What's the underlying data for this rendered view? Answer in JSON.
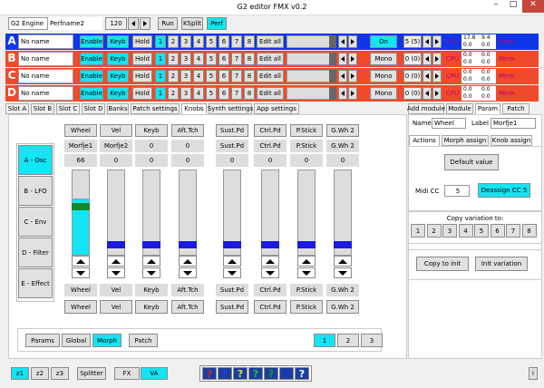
{
  "window": {
    "title": "G2 editor FMX v0.2"
  },
  "top": {
    "engine": "G2 Engine",
    "perf_name": "Perfname2",
    "tempo": "120",
    "run": "Run",
    "ksplit": "KSplit",
    "perf": "Perf"
  },
  "slots": [
    {
      "letter": "A",
      "name": "No name",
      "enable": "Enable",
      "keyb": "Keyb",
      "hold": "Hold",
      "vars": [
        "1",
        "2",
        "3",
        "4",
        "5",
        "6",
        "7",
        "8"
      ],
      "edit_all": "Edit all",
      "mode": "On",
      "voices": "5 (5)",
      "cpu": "CPU",
      "cpu1": "17.8",
      "cpu2": "9.4",
      "cpu3": "0.0",
      "cpu4": "0.0",
      "mem": "Mem",
      "color": "#0f36e8"
    },
    {
      "letter": "B",
      "name": "No name",
      "enable": "Enable",
      "keyb": "Keyb",
      "hold": "Hold",
      "vars": [
        "1",
        "2",
        "3",
        "4",
        "5",
        "6",
        "7",
        "8"
      ],
      "edit_all": "Edit all",
      "mode": "Mono",
      "voices": "0 (0)",
      "cpu": "CPU",
      "cpu1": "0.0",
      "cpu2": "0.0",
      "cpu3": "0.0",
      "cpu4": "0.0",
      "mem": "Mem",
      "color": "#f04a2a"
    },
    {
      "letter": "C",
      "name": "No name",
      "enable": "Enable",
      "keyb": "Keyb",
      "hold": "Hold",
      "vars": [
        "1",
        "2",
        "3",
        "4",
        "5",
        "6",
        "7",
        "8"
      ],
      "edit_all": "Edit all",
      "mode": "Mono",
      "voices": "0 (0)",
      "cpu": "CPU",
      "cpu1": "0.0",
      "cpu2": "0.0",
      "cpu3": "0.0",
      "cpu4": "0.0",
      "mem": "Mem",
      "color": "#f04a2a"
    },
    {
      "letter": "D",
      "name": "No name",
      "enable": "Enable",
      "keyb": "Keyb",
      "hold": "Hold",
      "vars": [
        "1",
        "2",
        "3",
        "4",
        "5",
        "6",
        "7",
        "8"
      ],
      "edit_all": "Edit all",
      "mode": "Mono",
      "voices": "0 (0)",
      "cpu": "CPU",
      "cpu1": "0.0",
      "cpu2": "0.0",
      "cpu3": "0.0",
      "cpu4": "0.0",
      "mem": "Mem",
      "color": "#f04a2a"
    }
  ],
  "tabs": [
    "Slot A",
    "Slot B",
    "Slot C",
    "Slot D",
    "Banks",
    "Patch settings",
    "Knobs",
    "Synth settings",
    "App settings"
  ],
  "right_tabs": [
    "Add module",
    "Module",
    "Param",
    "Patch"
  ],
  "side_buttons": [
    "A - Osc",
    "B - LFO",
    "C - Env",
    "D - Filter",
    "E - Effect"
  ],
  "knobs": [
    {
      "head": "Wheel",
      "sub": "Morfje1",
      "val": "66",
      "level": 0.66,
      "foot1": "Wheel",
      "foot2": "Wheel"
    },
    {
      "head": "Vel",
      "sub": "Morfje2",
      "val": "0",
      "level": 0,
      "foot1": "Vel",
      "foot2": "Vel"
    },
    {
      "head": "Keyb",
      "sub": "0",
      "val": "0",
      "level": 0,
      "foot1": "Keyb",
      "foot2": "Keyb"
    },
    {
      "head": "Aft.Tch",
      "sub": "0",
      "val": "0",
      "level": 0,
      "foot1": "Aft.Tch",
      "foot2": "Aft.Tch"
    },
    {
      "head": "Sust.Pd",
      "sub": "Sust.Pd",
      "val": "0",
      "level": 0,
      "foot1": "Sust.Pd",
      "foot2": "Sust.Pd"
    },
    {
      "head": "Ctrl.Pd",
      "sub": "Ctrl.Pd",
      "val": "0",
      "level": 0,
      "foot1": "Ctrl.Pd",
      "foot2": "Ctrl.Pd"
    },
    {
      "head": "P.Stick",
      "sub": "P.Stick",
      "val": "0",
      "level": 0,
      "foot1": "P.Stick",
      "foot2": "P.Stick"
    },
    {
      "head": "G.Wh 2",
      "sub": "G.Wh 2",
      "val": "0",
      "level": 0,
      "foot1": "G.Wh 2",
      "foot2": "G.Wh 2"
    }
  ],
  "bottom_tabs": [
    "Params",
    "Global",
    "Morph",
    "Patch"
  ],
  "pages": [
    "1",
    "2",
    "3"
  ],
  "param": {
    "name_label": "Name",
    "name_value": "Wheel",
    "label_label": "Label",
    "label_value": "Morfje1",
    "tabs": [
      "Actions",
      "Morph assign",
      "Knob assign"
    ],
    "default_value": "Default value",
    "midi_cc_label": "Midi CC",
    "midi_cc_value": "5",
    "deassign": "Deassign CC 5",
    "copy_label": "Copy variation to:",
    "copy_buttons": [
      "1",
      "2",
      "3",
      "4",
      "5",
      "6",
      "7",
      "8"
    ],
    "copy_to_init": "Copy to init",
    "init_variation": "Init variation"
  },
  "status": {
    "z1": "z1",
    "z2": "z2",
    "z3": "z3",
    "splitter": "Splitter",
    "fx": "FX",
    "va": "VA",
    "info": "i"
  },
  "question_colors": [
    "#e02020",
    "#2040e0",
    "#e0e020",
    "#20c040",
    "#20a020",
    "#2030d0",
    "#ffffff"
  ]
}
